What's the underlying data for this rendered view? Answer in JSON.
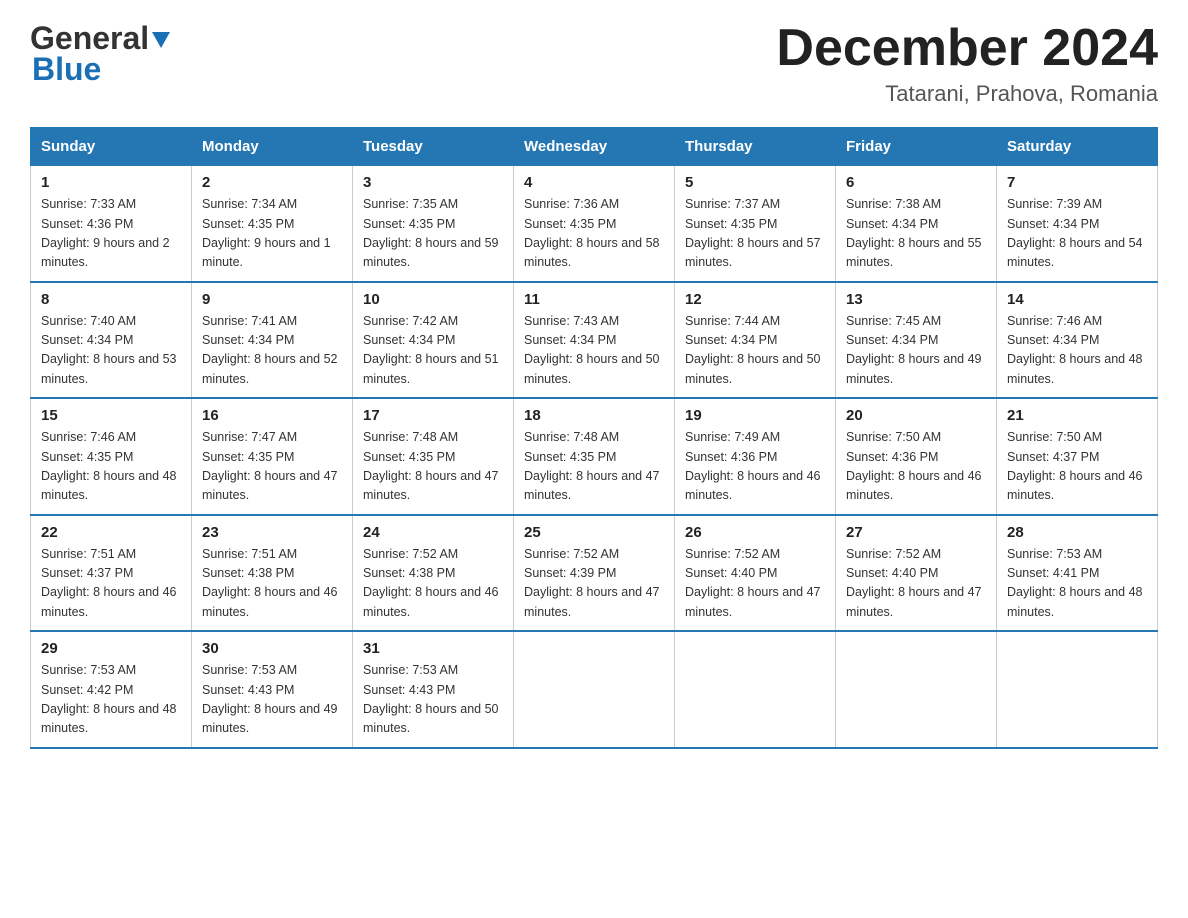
{
  "header": {
    "logo_general": "General",
    "logo_blue": "Blue",
    "title": "December 2024",
    "subtitle": "Tatarani, Prahova, Romania"
  },
  "columns": [
    "Sunday",
    "Monday",
    "Tuesday",
    "Wednesday",
    "Thursday",
    "Friday",
    "Saturday"
  ],
  "weeks": [
    [
      {
        "day": "1",
        "sunrise": "Sunrise: 7:33 AM",
        "sunset": "Sunset: 4:36 PM",
        "daylight": "Daylight: 9 hours and 2 minutes."
      },
      {
        "day": "2",
        "sunrise": "Sunrise: 7:34 AM",
        "sunset": "Sunset: 4:35 PM",
        "daylight": "Daylight: 9 hours and 1 minute."
      },
      {
        "day": "3",
        "sunrise": "Sunrise: 7:35 AM",
        "sunset": "Sunset: 4:35 PM",
        "daylight": "Daylight: 8 hours and 59 minutes."
      },
      {
        "day": "4",
        "sunrise": "Sunrise: 7:36 AM",
        "sunset": "Sunset: 4:35 PM",
        "daylight": "Daylight: 8 hours and 58 minutes."
      },
      {
        "day": "5",
        "sunrise": "Sunrise: 7:37 AM",
        "sunset": "Sunset: 4:35 PM",
        "daylight": "Daylight: 8 hours and 57 minutes."
      },
      {
        "day": "6",
        "sunrise": "Sunrise: 7:38 AM",
        "sunset": "Sunset: 4:34 PM",
        "daylight": "Daylight: 8 hours and 55 minutes."
      },
      {
        "day": "7",
        "sunrise": "Sunrise: 7:39 AM",
        "sunset": "Sunset: 4:34 PM",
        "daylight": "Daylight: 8 hours and 54 minutes."
      }
    ],
    [
      {
        "day": "8",
        "sunrise": "Sunrise: 7:40 AM",
        "sunset": "Sunset: 4:34 PM",
        "daylight": "Daylight: 8 hours and 53 minutes."
      },
      {
        "day": "9",
        "sunrise": "Sunrise: 7:41 AM",
        "sunset": "Sunset: 4:34 PM",
        "daylight": "Daylight: 8 hours and 52 minutes."
      },
      {
        "day": "10",
        "sunrise": "Sunrise: 7:42 AM",
        "sunset": "Sunset: 4:34 PM",
        "daylight": "Daylight: 8 hours and 51 minutes."
      },
      {
        "day": "11",
        "sunrise": "Sunrise: 7:43 AM",
        "sunset": "Sunset: 4:34 PM",
        "daylight": "Daylight: 8 hours and 50 minutes."
      },
      {
        "day": "12",
        "sunrise": "Sunrise: 7:44 AM",
        "sunset": "Sunset: 4:34 PM",
        "daylight": "Daylight: 8 hours and 50 minutes."
      },
      {
        "day": "13",
        "sunrise": "Sunrise: 7:45 AM",
        "sunset": "Sunset: 4:34 PM",
        "daylight": "Daylight: 8 hours and 49 minutes."
      },
      {
        "day": "14",
        "sunrise": "Sunrise: 7:46 AM",
        "sunset": "Sunset: 4:34 PM",
        "daylight": "Daylight: 8 hours and 48 minutes."
      }
    ],
    [
      {
        "day": "15",
        "sunrise": "Sunrise: 7:46 AM",
        "sunset": "Sunset: 4:35 PM",
        "daylight": "Daylight: 8 hours and 48 minutes."
      },
      {
        "day": "16",
        "sunrise": "Sunrise: 7:47 AM",
        "sunset": "Sunset: 4:35 PM",
        "daylight": "Daylight: 8 hours and 47 minutes."
      },
      {
        "day": "17",
        "sunrise": "Sunrise: 7:48 AM",
        "sunset": "Sunset: 4:35 PM",
        "daylight": "Daylight: 8 hours and 47 minutes."
      },
      {
        "day": "18",
        "sunrise": "Sunrise: 7:48 AM",
        "sunset": "Sunset: 4:35 PM",
        "daylight": "Daylight: 8 hours and 47 minutes."
      },
      {
        "day": "19",
        "sunrise": "Sunrise: 7:49 AM",
        "sunset": "Sunset: 4:36 PM",
        "daylight": "Daylight: 8 hours and 46 minutes."
      },
      {
        "day": "20",
        "sunrise": "Sunrise: 7:50 AM",
        "sunset": "Sunset: 4:36 PM",
        "daylight": "Daylight: 8 hours and 46 minutes."
      },
      {
        "day": "21",
        "sunrise": "Sunrise: 7:50 AM",
        "sunset": "Sunset: 4:37 PM",
        "daylight": "Daylight: 8 hours and 46 minutes."
      }
    ],
    [
      {
        "day": "22",
        "sunrise": "Sunrise: 7:51 AM",
        "sunset": "Sunset: 4:37 PM",
        "daylight": "Daylight: 8 hours and 46 minutes."
      },
      {
        "day": "23",
        "sunrise": "Sunrise: 7:51 AM",
        "sunset": "Sunset: 4:38 PM",
        "daylight": "Daylight: 8 hours and 46 minutes."
      },
      {
        "day": "24",
        "sunrise": "Sunrise: 7:52 AM",
        "sunset": "Sunset: 4:38 PM",
        "daylight": "Daylight: 8 hours and 46 minutes."
      },
      {
        "day": "25",
        "sunrise": "Sunrise: 7:52 AM",
        "sunset": "Sunset: 4:39 PM",
        "daylight": "Daylight: 8 hours and 47 minutes."
      },
      {
        "day": "26",
        "sunrise": "Sunrise: 7:52 AM",
        "sunset": "Sunset: 4:40 PM",
        "daylight": "Daylight: 8 hours and 47 minutes."
      },
      {
        "day": "27",
        "sunrise": "Sunrise: 7:52 AM",
        "sunset": "Sunset: 4:40 PM",
        "daylight": "Daylight: 8 hours and 47 minutes."
      },
      {
        "day": "28",
        "sunrise": "Sunrise: 7:53 AM",
        "sunset": "Sunset: 4:41 PM",
        "daylight": "Daylight: 8 hours and 48 minutes."
      }
    ],
    [
      {
        "day": "29",
        "sunrise": "Sunrise: 7:53 AM",
        "sunset": "Sunset: 4:42 PM",
        "daylight": "Daylight: 8 hours and 48 minutes."
      },
      {
        "day": "30",
        "sunrise": "Sunrise: 7:53 AM",
        "sunset": "Sunset: 4:43 PM",
        "daylight": "Daylight: 8 hours and 49 minutes."
      },
      {
        "day": "31",
        "sunrise": "Sunrise: 7:53 AM",
        "sunset": "Sunset: 4:43 PM",
        "daylight": "Daylight: 8 hours and 50 minutes."
      },
      null,
      null,
      null,
      null
    ]
  ]
}
